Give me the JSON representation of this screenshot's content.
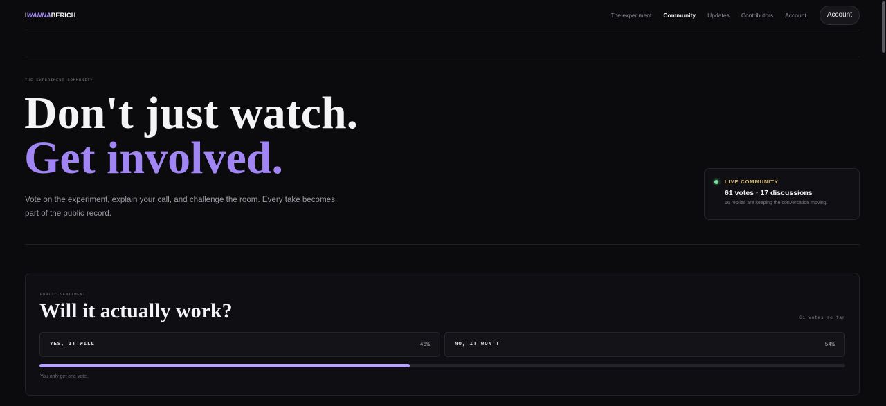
{
  "brand": {
    "part1": "I",
    "part2": "WANNA",
    "part3": "BERICH"
  },
  "nav": {
    "items": [
      {
        "label": "The experiment",
        "active": false
      },
      {
        "label": "Community",
        "active": true
      },
      {
        "label": "Updates",
        "active": false
      },
      {
        "label": "Contributors",
        "active": false
      },
      {
        "label": "Account",
        "active": false
      }
    ],
    "account_button": "Account"
  },
  "hero": {
    "eyebrow": "THE EXPERIMENT COMMUNITY",
    "headline_line1": "Don't just watch.",
    "headline_line2": "Get involved.",
    "lede": "Vote on the experiment, explain your call, and challenge the room. Every take becomes part of the public record."
  },
  "live": {
    "label": "LIVE COMMUNITY",
    "counts": "61 votes · 17 discussions",
    "sub": "16 replies are keeping the conversation moving."
  },
  "sentiment": {
    "eyebrow": "PUBLIC SENTIMENT",
    "title": "Will it actually work?",
    "count": "61 votes so far",
    "yes": {
      "label": "YES, IT WILL",
      "pct": "46%"
    },
    "no": {
      "label": "NO, IT WON'T",
      "pct": "54%"
    },
    "yes_fraction": 0.46,
    "note": "You only get one vote."
  },
  "colors": {
    "accent": "#a285f4",
    "bar_fill": "#b7a2ff",
    "live_dot": "#7be0a0",
    "live_label": "#d9b86a",
    "background": "#0b0b0e"
  }
}
